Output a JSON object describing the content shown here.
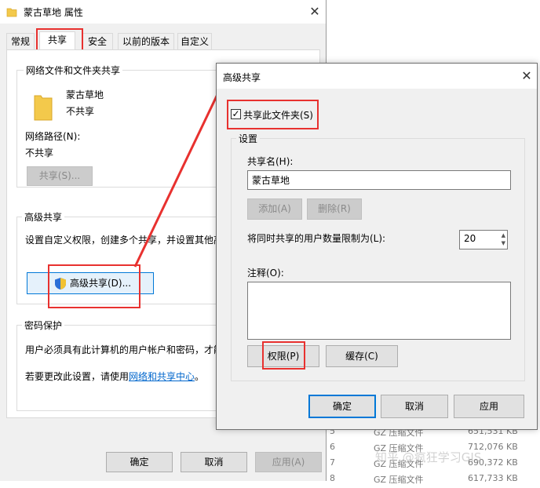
{
  "properties": {
    "title": "蒙古草地 属性",
    "tabs": [
      "常规",
      "共享",
      "安全",
      "以前的版本",
      "自定义"
    ],
    "network_group": {
      "title": "网络文件和文件夹共享",
      "folder_name": "蒙古草地",
      "status": "不共享",
      "path_label": "网络路径(N):",
      "path_value": "不共享",
      "share_button": "共享(S)..."
    },
    "advanced_group": {
      "title": "高级共享",
      "description": "设置自定义权限，创建多个共享，并设置其他高",
      "button": "高级共享(D)..."
    },
    "password_group": {
      "title": "密码保护",
      "line1": "用户必须具有此计算机的用户帐户和密码，才能",
      "line2_prefix": "若要更改此设置，请使用",
      "line2_link": "网络和共享中心",
      "line2_suffix": "。"
    },
    "buttons": {
      "ok": "确定",
      "cancel": "取消",
      "apply": "应用(A)"
    }
  },
  "advanced": {
    "title": "高级共享",
    "share_checkbox": {
      "label": "共享此文件夹(S)",
      "checked": true,
      "check_mark": "✓"
    },
    "settings_title": "设置",
    "share_name_label": "共享名(H):",
    "share_name_value": "蒙古草地",
    "add_button": "添加(A)",
    "remove_button": "删除(R)",
    "limit_label": "将同时共享的用户数量限制为(L):",
    "limit_value": "20",
    "comment_label": "注释(O):",
    "permissions_button": "权限(P)",
    "cache_button": "缓存(C)",
    "buttons": {
      "ok": "确定",
      "cancel": "取消",
      "apply": "应用"
    }
  },
  "background_files": [
    {
      "num": "5",
      "type": "GZ 压缩文件",
      "size": "651,531 KB"
    },
    {
      "num": "6",
      "type": "GZ 压缩文件",
      "size": "712,076 KB"
    },
    {
      "num": "7",
      "type": "GZ 压缩文件",
      "size": "690,372 KB"
    },
    {
      "num": "8",
      "type": "GZ 压缩文件",
      "size": "617,733 KB"
    }
  ],
  "watermark": "知乎 @疯狂学习GIS",
  "colors": {
    "highlight_red": "#e8312f",
    "accent_blue": "#0078d7",
    "link_blue": "#0066cc"
  }
}
